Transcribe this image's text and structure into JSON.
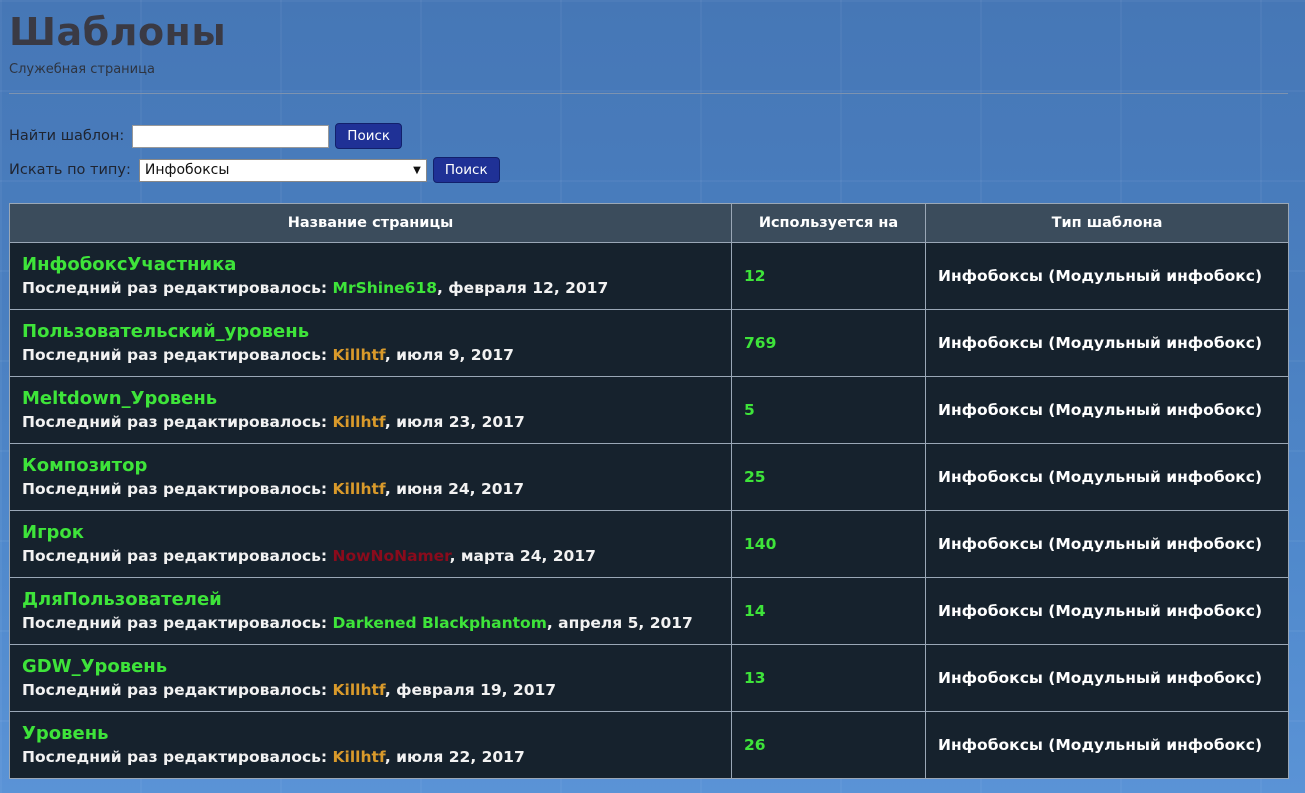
{
  "page": {
    "title": "Шаблоны",
    "subtitle": "Служебная страница"
  },
  "search": {
    "label": "Найти шаблон:",
    "value": "",
    "button": "Поиск"
  },
  "type_filter": {
    "label": "Искать по типу:",
    "selected": "Инфобоксы",
    "button": "Поиск"
  },
  "table": {
    "headers": [
      "Название страницы",
      "Используется на",
      "Тип шаблона"
    ],
    "meta_prefix": "Последний раз редактировалось:",
    "rows": [
      {
        "name": "ИнфобоксУчастника",
        "user": "MrShine618",
        "user_color": "#3ee43a",
        "date": ", февраля 12, 2017",
        "count": "12",
        "type": "Инфобоксы (Модульный инфобокс)"
      },
      {
        "name": "Пользовательский_уровень",
        "user": "Killhtf",
        "user_color": "#d99a2b",
        "date": ", июля 9, 2017",
        "count": "769",
        "type": "Инфобоксы (Модульный инфобокс)"
      },
      {
        "name": "Meltdown_Уровень",
        "user": "Killhtf",
        "user_color": "#d99a2b",
        "date": ", июля 23, 2017",
        "count": "5",
        "type": "Инфобоксы (Модульный инфобокс)"
      },
      {
        "name": "Композитор",
        "user": "Killhtf",
        "user_color": "#d99a2b",
        "date": ", июня 24, 2017",
        "count": "25",
        "type": "Инфобоксы (Модульный инфобокс)"
      },
      {
        "name": "Игрок",
        "user": "NowNoNamer",
        "user_color": "#8a0b1c",
        "date": ", марта 24, 2017",
        "count": "140",
        "type": "Инфобоксы (Модульный инфобокс)"
      },
      {
        "name": "ДляПользователей",
        "user": "Darkened Blackphantom",
        "user_color": "#3ee43a",
        "date": ", апреля 5, 2017",
        "count": "14",
        "type": "Инфобоксы (Модульный инфобокс)"
      },
      {
        "name": "GDW_Уровень",
        "user": "Killhtf",
        "user_color": "#d99a2b",
        "date": ", февраля 19, 2017",
        "count": "13",
        "type": "Инфобоксы (Модульный инфобокс)"
      },
      {
        "name": "Уровень",
        "user": "Killhtf",
        "user_color": "#d99a2b",
        "date": ", июля 22, 2017",
        "count": "26",
        "type": "Инфобоксы (Модульный инфобокс)"
      }
    ]
  }
}
